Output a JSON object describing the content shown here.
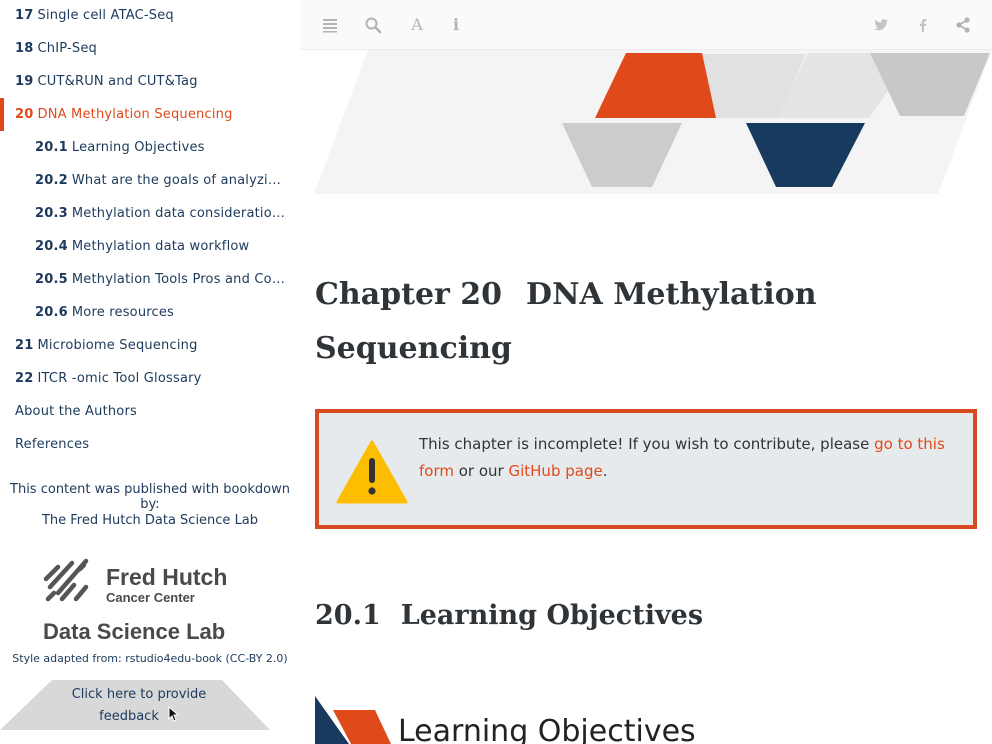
{
  "sidebar": {
    "items": [
      {
        "num": "17",
        "label": "Single cell ATAC-Seq"
      },
      {
        "num": "18",
        "label": "ChIP-Seq"
      },
      {
        "num": "19",
        "label": "CUT&RUN and CUT&Tag"
      },
      {
        "num": "20",
        "label": "DNA Methylation Sequencing"
      },
      {
        "num": "20.1",
        "label": "Learning Objectives"
      },
      {
        "num": "20.2",
        "label": "What are the goals of analyzing DNA methylation data?"
      },
      {
        "num": "20.3",
        "label": "Methylation data considerations"
      },
      {
        "num": "20.4",
        "label": "Methylation data workflow"
      },
      {
        "num": "20.5",
        "label": "Methylation Tools Pros and Cons"
      },
      {
        "num": "20.6",
        "label": "More resources"
      },
      {
        "num": "21",
        "label": "Microbiome Sequencing"
      },
      {
        "num": "22",
        "label": "ITCR -omic Tool Glossary"
      },
      {
        "num": "",
        "label": "About the Authors"
      },
      {
        "num": "",
        "label": "References"
      }
    ],
    "published_by": "This content was published with bookdown by:",
    "lab_link": "The Fred Hutch Data Science Lab",
    "logo": {
      "line1": "Fred Hutch",
      "line2": "Cancer Center",
      "line3": "Data Science Lab"
    },
    "style_adapted": "Style adapted from: rstudio4edu-book (CC-BY 2.0)",
    "feedback": {
      "line1": "Click here to provide",
      "line2": "feedback"
    }
  },
  "toolbar": {
    "left_icons": [
      "menu-icon",
      "search-icon",
      "font-icon",
      "info-icon"
    ],
    "right_icons": [
      "twitter-icon",
      "facebook-icon",
      "share-icon"
    ],
    "font_glyph": "A",
    "info_glyph": "i"
  },
  "content": {
    "chapter_prefix": "Chapter 20",
    "chapter_title": "DNA Methylation Sequencing",
    "callout": {
      "text_before": "This chapter is incomplete! If you wish to contribute, please ",
      "link1": "go to this form",
      "text_middle": " or our ",
      "link2": "GitHub page",
      "text_after": "."
    },
    "section_number": "20.1",
    "section_title": "Learning Objectives",
    "lo_heading": "Learning Objectives"
  },
  "colors": {
    "accent": "#e04a1a",
    "navy": "#1d3a5c",
    "callout_bg": "#e7eaed",
    "banner_gray": "#d0d0d0"
  }
}
